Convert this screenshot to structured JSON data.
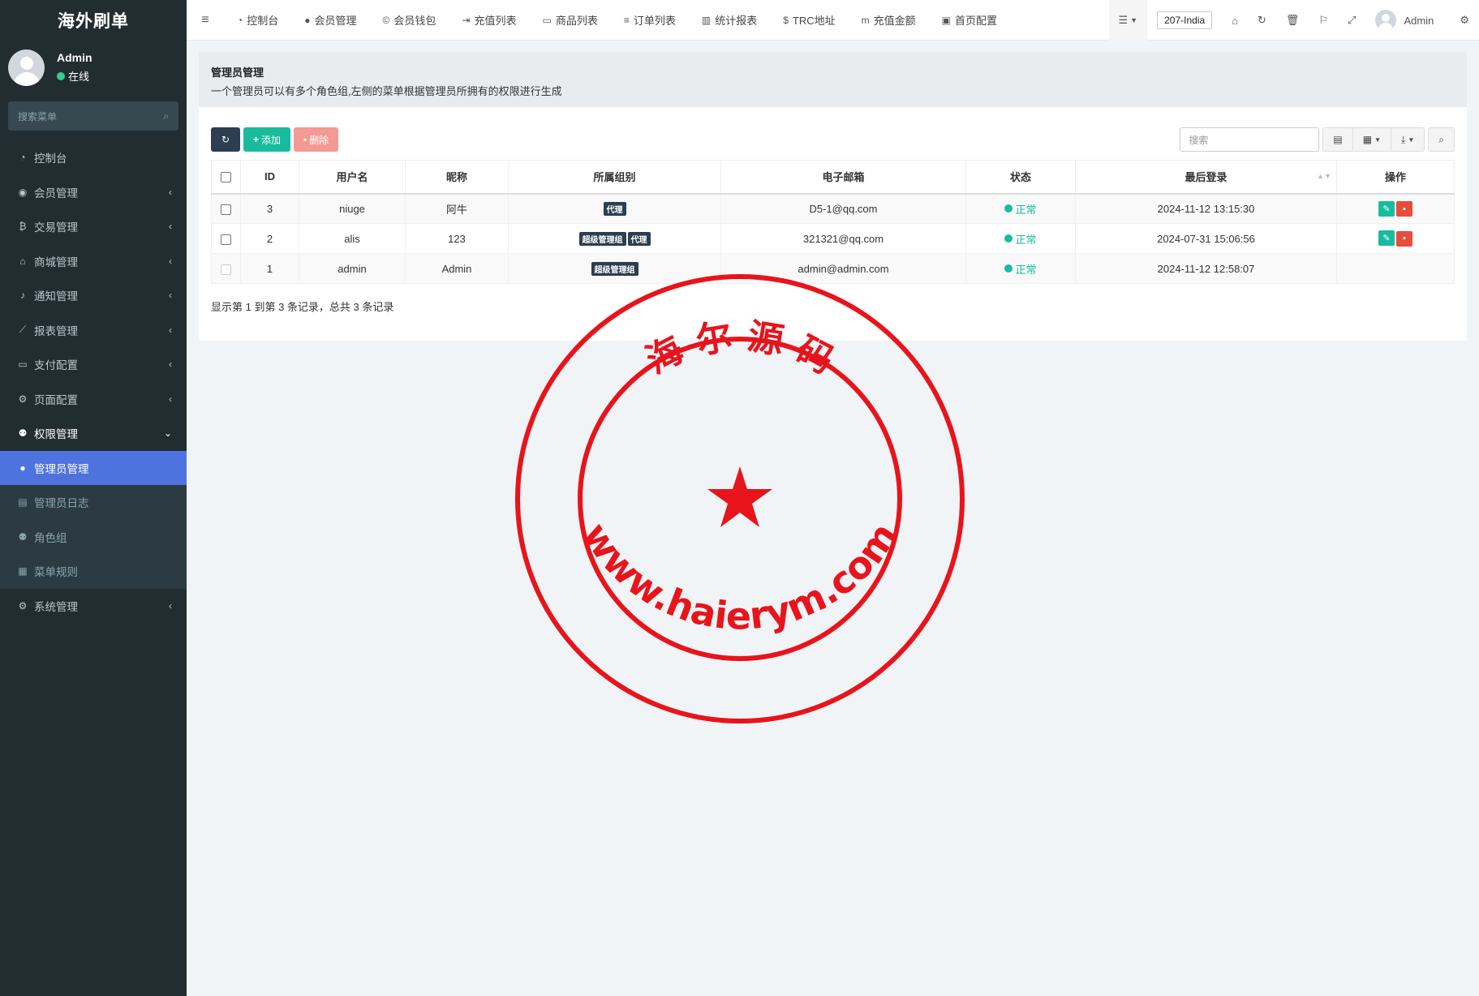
{
  "sidebar": {
    "logo": "海外刷单",
    "user": {
      "name": "Admin",
      "status": "在线"
    },
    "search_placeholder": "搜索菜单",
    "menu": [
      {
        "label": "控制台",
        "icon": "dashboard-icon",
        "glyph": "◔"
      },
      {
        "label": "会员管理",
        "icon": "user-circle-icon",
        "glyph": "◉",
        "arrow": "‹"
      },
      {
        "label": "交易管理",
        "icon": "bitcoin-icon",
        "glyph": "₿",
        "arrow": "‹"
      },
      {
        "label": "商城管理",
        "icon": "home-icon",
        "glyph": "⌂",
        "arrow": "‹"
      },
      {
        "label": "通知管理",
        "icon": "bell-icon",
        "glyph": "♪",
        "arrow": "‹"
      },
      {
        "label": "报表管理",
        "icon": "line-chart-icon",
        "glyph": "⟋",
        "arrow": "‹"
      },
      {
        "label": "支付配置",
        "icon": "credit-card-icon",
        "glyph": "▭",
        "arrow": "‹"
      },
      {
        "label": "页面配置",
        "icon": "gear-icon",
        "glyph": "⚙",
        "arrow": "‹"
      },
      {
        "label": "权限管理",
        "icon": "users-icon",
        "glyph": "⚉",
        "arrow": "⌄"
      }
    ],
    "submenu": [
      {
        "label": "管理员管理",
        "icon": "user-icon",
        "glyph": "●"
      },
      {
        "label": "管理员日志",
        "icon": "list-alt-icon",
        "glyph": "▤"
      },
      {
        "label": "角色组",
        "icon": "group-icon",
        "glyph": "⚉"
      },
      {
        "label": "菜单规则",
        "icon": "windows-icon",
        "glyph": "▦"
      }
    ],
    "last_menu": {
      "label": "系统管理",
      "icon": "cogs-icon",
      "glyph": "⚙",
      "arrow": "‹"
    }
  },
  "topnav": {
    "links": [
      {
        "label": "控制台",
        "icon": "dashboard-icon",
        "glyph": "◔"
      },
      {
        "label": "会员管理",
        "icon": "user-icon",
        "glyph": "●"
      },
      {
        "label": "会员钱包",
        "icon": "cc-icon",
        "glyph": "©"
      },
      {
        "label": "充值列表",
        "icon": "sign-in-icon",
        "glyph": "⇥"
      },
      {
        "label": "商品列表",
        "icon": "desktop-icon",
        "glyph": "▭"
      },
      {
        "label": "订单列表",
        "icon": "bars-icon",
        "glyph": "≡"
      },
      {
        "label": "统计报表",
        "icon": "bar-chart-icon",
        "glyph": "▥"
      },
      {
        "label": "TRC地址",
        "icon": "dollar-icon",
        "glyph": "$"
      },
      {
        "label": "充值金额",
        "icon": "money-icon",
        "glyph": "m"
      },
      {
        "label": "首页配置",
        "icon": "save-icon",
        "glyph": "▣"
      }
    ],
    "site_select": "207-India",
    "admin_name": "Admin"
  },
  "page": {
    "title": "管理员管理",
    "description": "一个管理员可以有多个角色组,左侧的菜单根据管理员所拥有的权限进行生成"
  },
  "toolbar": {
    "add_label": "添加",
    "delete_label": "删除",
    "search_placeholder": "搜索"
  },
  "table": {
    "headers": [
      "ID",
      "用户名",
      "昵称",
      "所属组别",
      "电子邮箱",
      "状态",
      "最后登录",
      "操作"
    ],
    "rows": [
      {
        "id": "3",
        "username": "niuge",
        "nickname": "阿牛",
        "groups": [
          "代理"
        ],
        "email": "D5-1@qq.com",
        "status": "正常",
        "last_login": "2024-11-12 13:15:30",
        "editable": true
      },
      {
        "id": "2",
        "username": "alis",
        "nickname": "123",
        "groups": [
          "超级管理组",
          "代理"
        ],
        "email": "321321@qq.com",
        "status": "正常",
        "last_login": "2024-07-31 15:06:56",
        "editable": true
      },
      {
        "id": "1",
        "username": "admin",
        "nickname": "Admin",
        "groups": [
          "超级管理组"
        ],
        "email": "admin@admin.com",
        "status": "正常",
        "last_login": "2024-11-12 12:58:07",
        "editable": false
      }
    ],
    "footer": "显示第 1 到第 3 条记录，总共 3 条记录"
  },
  "watermark": {
    "top_text": "海 尔 源 码",
    "bottom_text": "www.haierym.com",
    "color": "#e8141c"
  },
  "colors": {
    "sidebar_bg": "#222d32",
    "active": "#4e73df",
    "success": "#18bc9c",
    "danger": "#e74c3c",
    "dark": "#2c3e50"
  }
}
